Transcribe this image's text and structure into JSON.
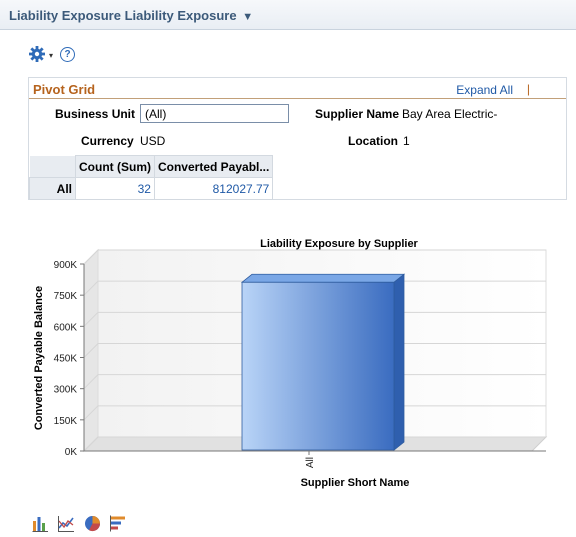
{
  "header": {
    "title": "Liability Exposure Liability Exposure",
    "caret": "▼"
  },
  "toolbar": {
    "menu_caret": "▾",
    "help_label": "?"
  },
  "pivot": {
    "title": "Pivot Grid",
    "expand_all": "Expand All",
    "separator": "|",
    "filters": {
      "business_unit_label": "Business Unit",
      "business_unit_value": "(All)",
      "supplier_name_label": "Supplier Name",
      "supplier_name_value": "Bay Area Electric-",
      "currency_label": "Currency",
      "currency_value": "USD",
      "location_label": "Location",
      "location_value": "1"
    },
    "grid": {
      "columns": [
        "Count (Sum)",
        "Converted Payabl..."
      ],
      "rows": [
        {
          "label": "All",
          "cells": [
            "32",
            "812027.77"
          ]
        }
      ]
    }
  },
  "chart_data": {
    "type": "bar",
    "title": "Liability Exposure by Supplier",
    "xlabel": "Supplier Short Name",
    "ylabel": "Converted Payable Balance",
    "categories": [
      "All"
    ],
    "values": [
      812027.77
    ],
    "ylim": [
      0,
      900000
    ],
    "yticks": [
      0,
      150000,
      300000,
      450000,
      600000,
      750000,
      900000
    ],
    "ytick_labels": [
      "0K",
      "150K",
      "300K",
      "450K",
      "600K",
      "750K",
      "900K"
    ],
    "grid": true,
    "legend": "none",
    "bar_color": "#5b8fd8"
  },
  "chart_type_icons": [
    "bar-chart-icon",
    "line-chart-icon",
    "pie-chart-icon",
    "horizontal-bar-chart-icon"
  ]
}
